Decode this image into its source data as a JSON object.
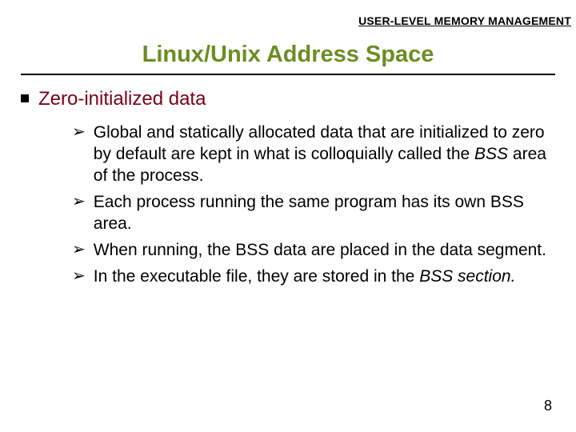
{
  "header_label": "USER-LEVEL MEMORY MANAGEMENT",
  "title": "Linux/Unix Address Space",
  "section_heading": "Zero-initialized data",
  "bullets": [
    {
      "pre": "Global and statically allocated data that are initialized to zero by default are kept in what is colloquially called the ",
      "em": "BSS",
      "post": " area of the process."
    },
    {
      "pre": " Each process running the same program has its own BSS area.",
      "em": "",
      "post": ""
    },
    {
      "pre": " When running, the BSS data are placed in the data segment.",
      "em": "",
      "post": ""
    },
    {
      "pre": "In the executable file, they are stored in the ",
      "em": "BSS section.",
      "post": ""
    }
  ],
  "page_number": "8",
  "arrow_glyph": "➢"
}
